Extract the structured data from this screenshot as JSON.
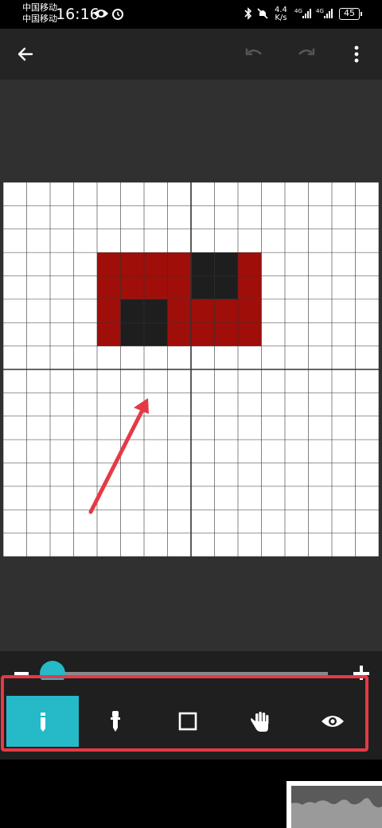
{
  "status_bar": {
    "carrier_1": "中国移动",
    "carrier_2": "中国移动",
    "time": "16:16",
    "net_speed_value": "4.4",
    "net_speed_unit": "K/s",
    "battery": "45"
  },
  "colors": {
    "accent": "#26b9c8",
    "red_pixel": "#a00e0a",
    "dark_pixel": "#1e1e1e",
    "grid_line": "#333333",
    "annotation": "#e63946"
  },
  "app_bar": {
    "icons": [
      "back-arrow-icon",
      "undo-icon",
      "redo-icon",
      "more-vert-icon"
    ]
  },
  "pixel_grid": {
    "cols": 16,
    "rows": 16,
    "rows_data": [
      "................",
      "................",
      "................",
      "....RRRRDDR.....",
      "....RRRRDDR.....",
      "....RDDRRRR.....",
      "....RDDRRRR.....",
      "................",
      "................",
      "................",
      "................",
      "................",
      "................",
      "................",
      "................",
      "................"
    ]
  },
  "zoom_slider": {
    "level": 0.03
  },
  "toolbar": {
    "tools": [
      {
        "name": "pencil",
        "icon": "pencil-icon",
        "active": true
      },
      {
        "name": "eyedropper",
        "icon": "eyedropper-icon",
        "active": false
      },
      {
        "name": "eraser",
        "icon": "square-icon",
        "active": false
      },
      {
        "name": "pan",
        "icon": "hand-icon",
        "active": false
      },
      {
        "name": "preview",
        "icon": "eye-icon",
        "active": false
      }
    ]
  }
}
